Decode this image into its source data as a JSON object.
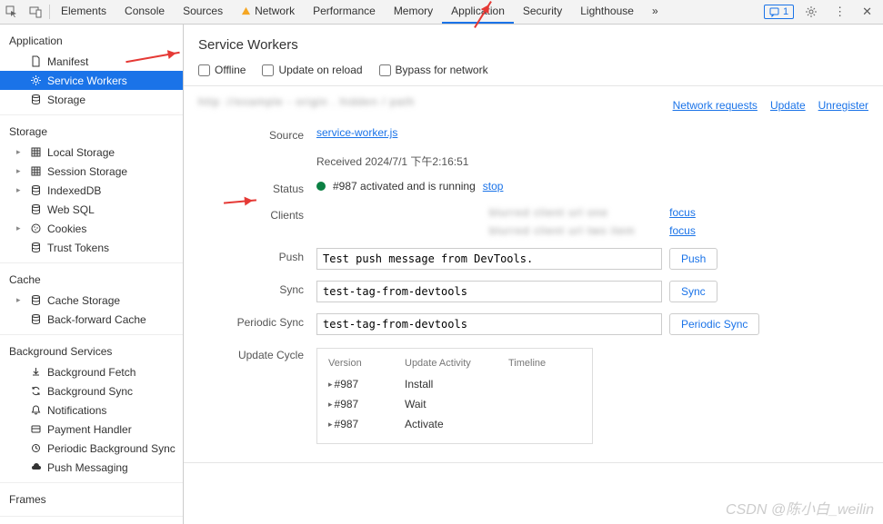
{
  "toolbar": {
    "tabs": [
      "Elements",
      "Console",
      "Sources",
      "Network",
      "Performance",
      "Memory",
      "Application",
      "Security",
      "Lighthouse"
    ],
    "active_tab": "Application",
    "msg_count": "1"
  },
  "sidebar": {
    "sections": [
      {
        "title": "Application",
        "items": [
          {
            "label": "Manifest",
            "icon": "file"
          },
          {
            "label": "Service Workers",
            "icon": "gear",
            "selected": true
          },
          {
            "label": "Storage",
            "icon": "db"
          }
        ]
      },
      {
        "title": "Storage",
        "items": [
          {
            "label": "Local Storage",
            "icon": "grid",
            "expand": true
          },
          {
            "label": "Session Storage",
            "icon": "grid",
            "expand": true
          },
          {
            "label": "IndexedDB",
            "icon": "db",
            "expand": true
          },
          {
            "label": "Web SQL",
            "icon": "db"
          },
          {
            "label": "Cookies",
            "icon": "cookie",
            "expand": true
          },
          {
            "label": "Trust Tokens",
            "icon": "db"
          }
        ]
      },
      {
        "title": "Cache",
        "items": [
          {
            "label": "Cache Storage",
            "icon": "db",
            "expand": true
          },
          {
            "label": "Back-forward Cache",
            "icon": "db"
          }
        ]
      },
      {
        "title": "Background Services",
        "items": [
          {
            "label": "Background Fetch",
            "icon": "fetch"
          },
          {
            "label": "Background Sync",
            "icon": "sync"
          },
          {
            "label": "Notifications",
            "icon": "bell"
          },
          {
            "label": "Payment Handler",
            "icon": "card"
          },
          {
            "label": "Periodic Background Sync",
            "icon": "psync"
          },
          {
            "label": "Push Messaging",
            "icon": "cloud"
          }
        ]
      },
      {
        "title": "Frames",
        "items": []
      }
    ]
  },
  "page": {
    "title": "Service Workers",
    "chk_offline": "Offline",
    "chk_update": "Update on reload",
    "chk_bypass": "Bypass for network",
    "links": {
      "nr": "Network requests",
      "upd": "Update",
      "unreg": "Unregister"
    },
    "labels": {
      "source": "Source",
      "status": "Status",
      "clients": "Clients",
      "push": "Push",
      "sync": "Sync",
      "periodic": "Periodic Sync",
      "cycle": "Update Cycle"
    },
    "source_file": "service-worker.js",
    "received": "Received 2024/7/1 下午2:16:51",
    "status_text": "#987 activated and is running",
    "stop": "stop",
    "focus": "focus",
    "push_val": "Test push message from DevTools.",
    "push_btn": "Push",
    "sync_val": "test-tag-from-devtools",
    "sync_btn": "Sync",
    "periodic_val": "test-tag-from-devtools",
    "periodic_btn": "Periodic Sync",
    "cycle": {
      "head": [
        "Version",
        "Update Activity",
        "Timeline"
      ],
      "rows": [
        {
          "v": "#987",
          "a": "Install"
        },
        {
          "v": "#987",
          "a": "Wait"
        },
        {
          "v": "#987",
          "a": "Activate"
        }
      ]
    }
  },
  "watermark": "CSDN @陈小白_weilin"
}
